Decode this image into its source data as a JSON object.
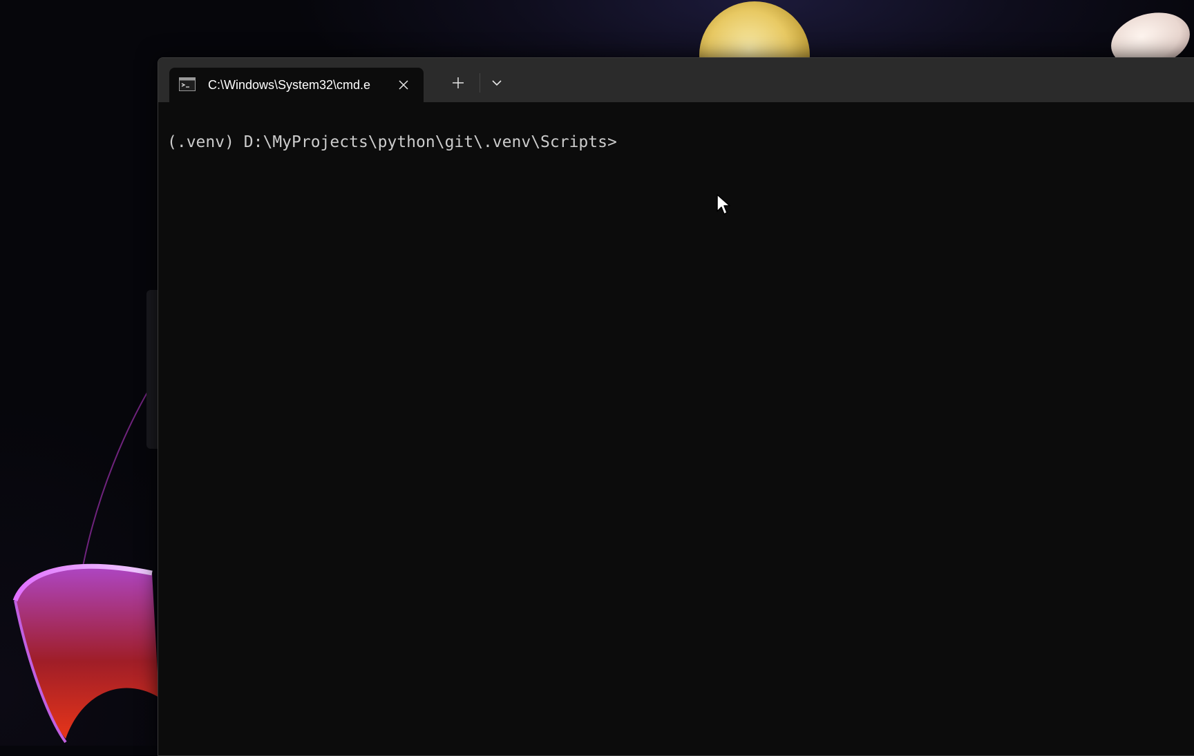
{
  "window": {
    "tab": {
      "title": "C:\\Windows\\System32\\cmd.e",
      "icon": "cmd-terminal-icon"
    },
    "buttons": {
      "close_icon": "close-icon",
      "new_tab_icon": "plus-icon",
      "dropdown_icon": "chevron-down-icon"
    }
  },
  "terminal": {
    "prompt": "(.venv) D:\\MyProjects\\python\\git\\.venv\\Scripts>"
  },
  "colors": {
    "terminal_background": "#0c0c0c",
    "tab_strip": "#2b2b2b",
    "prompt_text": "#cccccc",
    "tab_text": "#ffffff"
  }
}
